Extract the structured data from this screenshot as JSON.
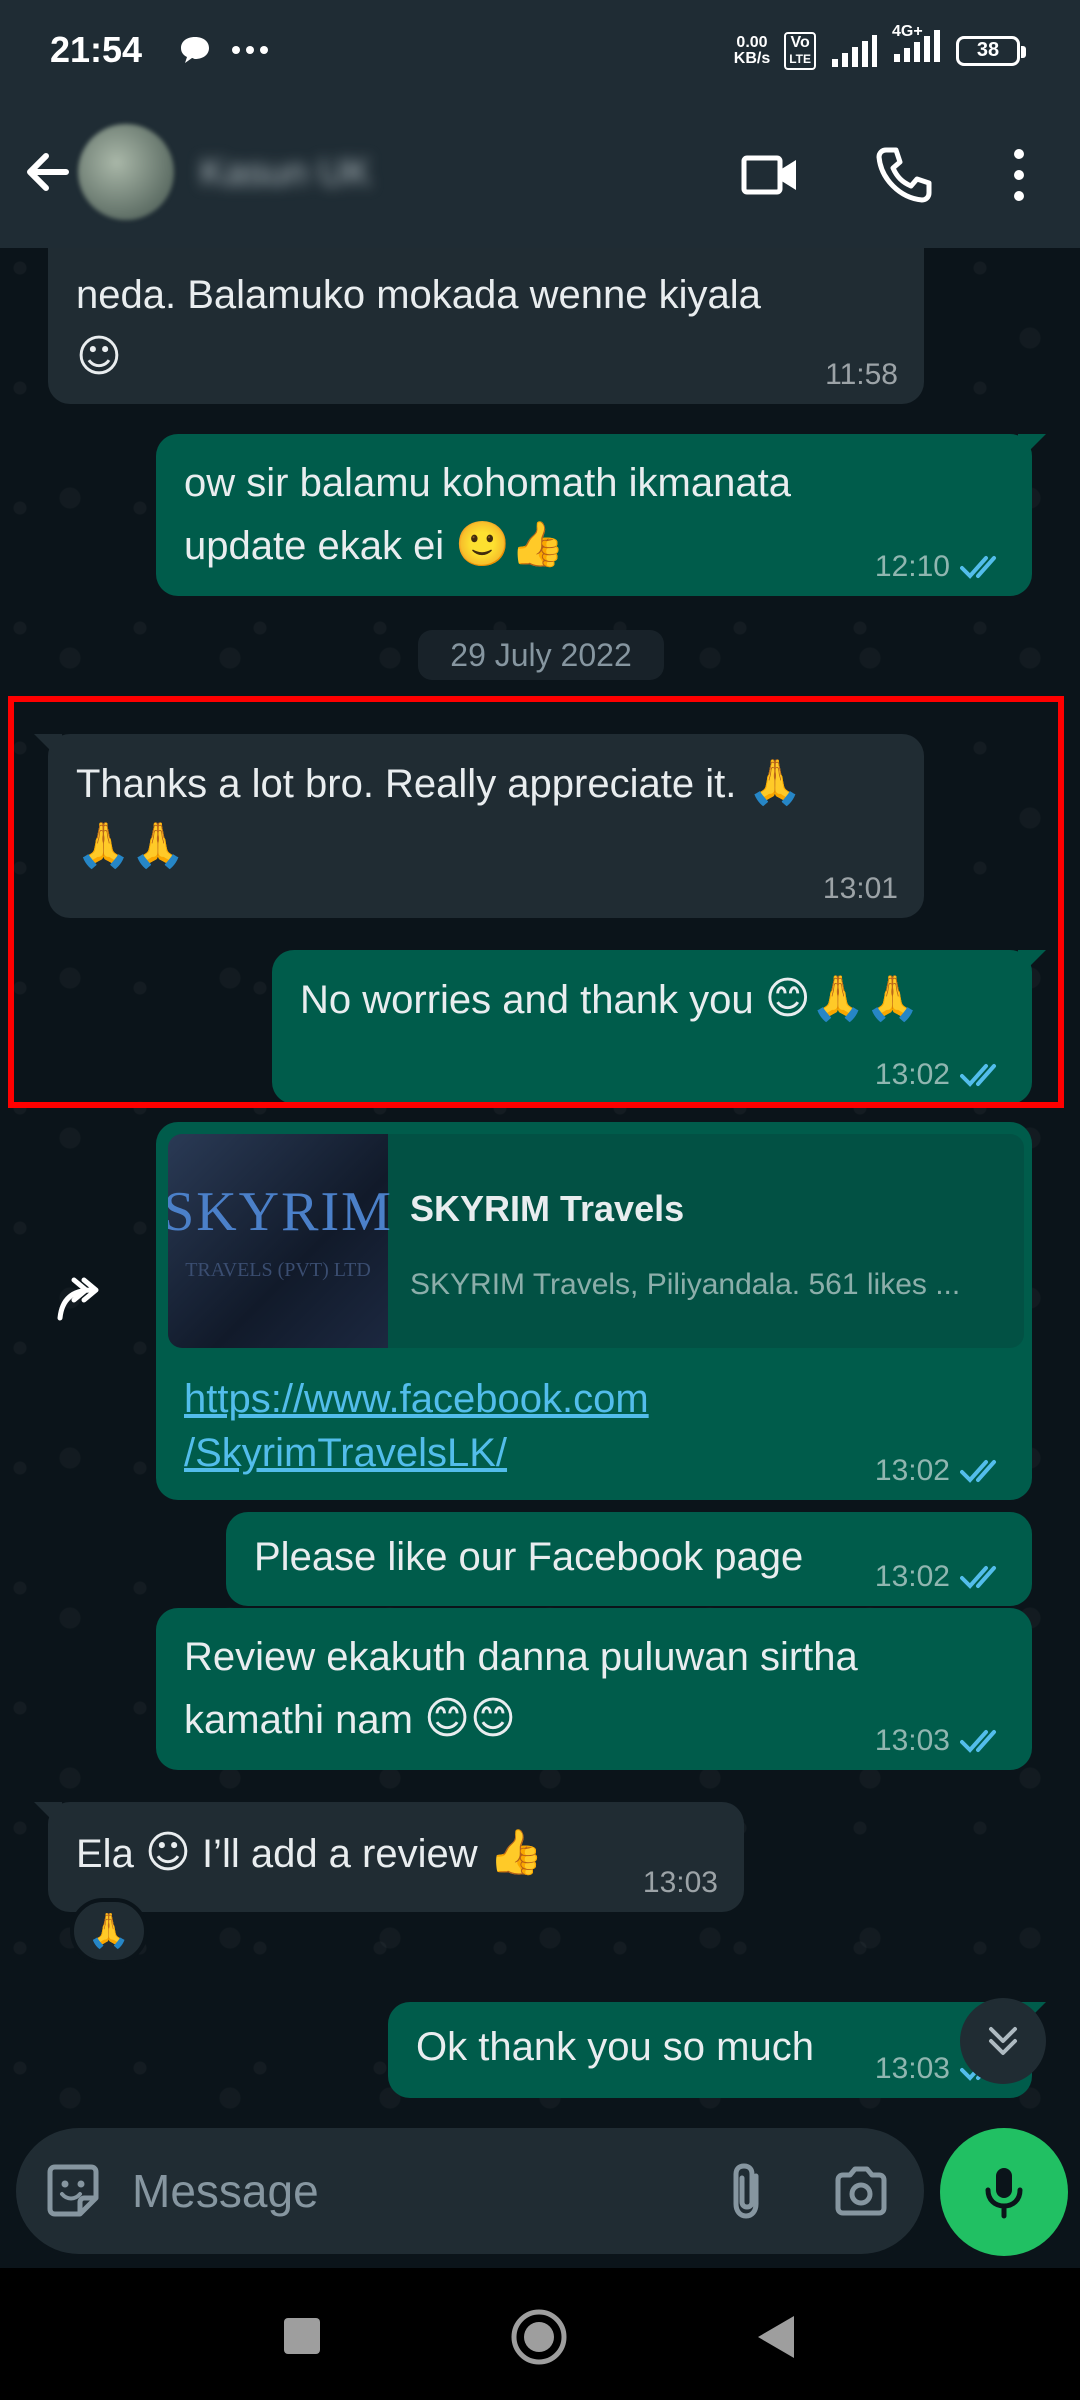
{
  "status_bar": {
    "time": "21:54",
    "net_speed_top": "0.00",
    "net_speed_bottom": "KB/s",
    "volte_top": "Vo",
    "volte_bottom": "LTE",
    "network_label": "4G+",
    "battery": "38"
  },
  "app_bar": {
    "contact_name": "Kasun UK"
  },
  "chat": {
    "date_divider": "29 July 2022",
    "messages": [
      {
        "text": "neda. Balamuko mokada wenne kiyala",
        "emoji": "☺",
        "time": "11:58"
      },
      {
        "text_line1": "ow sir balamu kohomath ikmanata",
        "text_line2": "update ekak ei",
        "emoji": "🙂👍",
        "time": "12:10"
      },
      {
        "text": "Thanks a lot bro. Really appreciate it.",
        "emoji_line1": "🙏",
        "emoji_line2": "🙏🙏",
        "time": "13:01"
      },
      {
        "text": "No worries and thank you",
        "emoji": "😊🙏🙏",
        "time": "13:02"
      },
      {
        "link_preview": {
          "thumb_logo": "SKYRIM",
          "thumb_sub": "TRAVELS (PVT) LTD",
          "title": "SKYRIM Travels",
          "description": "SKYRIM Travels, Piliyandala. 561 likes ...",
          "site": "www.facebook.com"
        },
        "url_line1": "https://www.facebook.com",
        "url_line2": "/SkyrimTravelsLK/",
        "time": "13:02"
      },
      {
        "text": "Please like our Facebook page",
        "time": "13:02"
      },
      {
        "text_line1": "Review ekakuth danna puluwan sirtha",
        "text_line2": "kamathi nam",
        "emoji": "😊😊",
        "time": "13:03"
      },
      {
        "text_before": "Ela",
        "emoji1": "☺",
        "text_after": "I’ll add a review",
        "emoji2": "👍",
        "time": "13:03",
        "reaction": "🙏"
      },
      {
        "text": "Ok thank you so much",
        "time": "13:03"
      }
    ]
  },
  "composer": {
    "placeholder": "Message"
  },
  "colors": {
    "outgoing_bubble": "#005c4b",
    "incoming_bubble": "#202c33",
    "mic_button": "#21c063",
    "highlight_border": "#ff0000",
    "read_tick": "#53bdeb"
  }
}
